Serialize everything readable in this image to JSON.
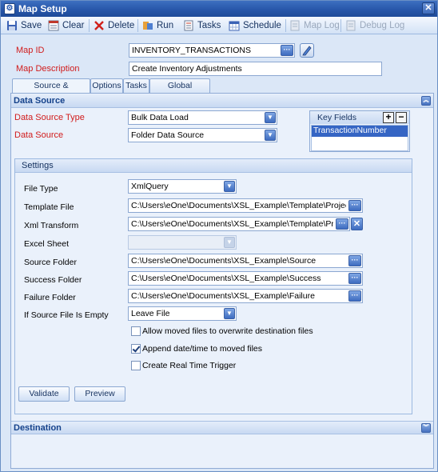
{
  "window": {
    "title": "Map Setup",
    "icon": "app-icon"
  },
  "toolbar": {
    "save": "Save",
    "clear": "Clear",
    "delete": "Delete",
    "run": "Run",
    "tasks": "Tasks",
    "schedule": "Schedule",
    "map_log": "Map Log",
    "debug_log": "Debug Log"
  },
  "map": {
    "id_label": "Map ID",
    "id_value": "INVENTORY_TRANSACTIONS",
    "desc_label": "Map Description",
    "desc_value": "Create Inventory Adjustments"
  },
  "tabs": [
    "Source & Destination",
    "Options",
    "Tasks",
    "Global Variables"
  ],
  "data_source": {
    "header": "Data Source",
    "type_label": "Data Source Type",
    "type_value": "Bulk Data Load",
    "source_label": "Data Source",
    "source_value": "Folder Data Source",
    "key_fields_header": "Key Fields",
    "key_fields": [
      "TransactionNumber"
    ]
  },
  "settings": {
    "header": "Settings",
    "file_type_label": "File Type",
    "file_type_value": "XmlQuery",
    "template_file_label": "Template File",
    "template_file_value": "C:\\Users\\eOne\\Documents\\XSL_Example\\Template\\ProjectInvento",
    "xml_transform_label": "Xml Transform",
    "xml_transform_value": "C:\\Users\\eOne\\Documents\\XSL_Example\\Template\\ProjectInve",
    "excel_sheet_label": "Excel Sheet",
    "excel_sheet_value": "",
    "source_folder_label": "Source Folder",
    "source_folder_value": "C:\\Users\\eOne\\Documents\\XSL_Example\\Source",
    "success_folder_label": "Success Folder",
    "success_folder_value": "C:\\Users\\eOne\\Documents\\XSL_Example\\Success",
    "failure_folder_label": "Failure Folder",
    "failure_folder_value": "C:\\Users\\eOne\\Documents\\XSL_Example\\Failure",
    "empty_label": "If Source File Is Empty",
    "empty_value": "Leave File",
    "checkboxes": [
      {
        "label": "Allow moved files to overwrite destination files",
        "checked": false
      },
      {
        "label": "Append date/time to moved files",
        "checked": true
      },
      {
        "label": "Create Real Time Trigger",
        "checked": false
      }
    ],
    "validate": "Validate",
    "preview": "Preview"
  },
  "destination": {
    "header": "Destination"
  },
  "colors": {
    "title": "#2655a8",
    "header_text": "#15428b",
    "required_label": "#d11c1c"
  }
}
